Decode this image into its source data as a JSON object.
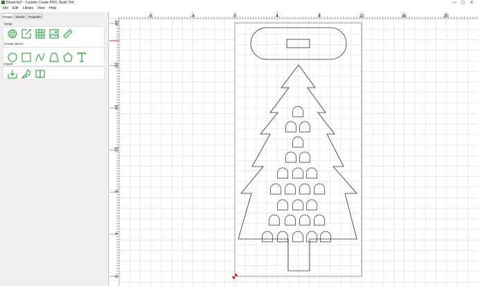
{
  "window": {
    "title": "[Need fix]* - Carbide Create PRO, Build 764",
    "controls": {
      "minimize": "—",
      "maximize": "▢",
      "close": "✕"
    }
  },
  "menu": [
    "File",
    "Edit",
    "Library",
    "View",
    "Help"
  ],
  "tabs": [
    {
      "label": "Design",
      "active": true
    },
    {
      "label": "Model",
      "active": false
    },
    {
      "label": "Toolpaths",
      "active": false
    }
  ],
  "groups": {
    "setup": {
      "label": "Setup",
      "tools": [
        "job-setup-gear-icon",
        "edit-document-icon",
        "grid-icon",
        "image-icon",
        "ruler-measure-icon"
      ]
    },
    "create_vector": {
      "label": "Create Vector",
      "tools": [
        "circle-icon",
        "rectangle-icon",
        "curve-icon",
        "polyline-icon",
        "polygon-icon",
        "text-icon"
      ]
    },
    "import": {
      "label": "Import",
      "tools": [
        "import-vectors-icon",
        "import-shapes-icon",
        "import-book-icon"
      ]
    }
  },
  "ruler": {
    "x_labels": [
      "-8",
      "-4",
      "0",
      "4",
      "8",
      "12",
      "16",
      "20"
    ],
    "y_labels": [
      "24",
      "20",
      "16",
      "12",
      "8",
      "4",
      "0"
    ]
  },
  "colors": {
    "accent_icon": "#3aa64a",
    "grid": "#d6d6d6",
    "stock": "#ffffff",
    "vector": "#2a2a2a",
    "origin": "#e02020"
  }
}
